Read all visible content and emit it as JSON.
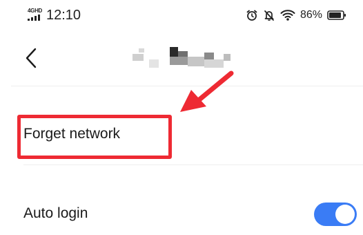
{
  "status_bar": {
    "network_type": "4GHD",
    "time": "12:10",
    "battery_percent": "86%",
    "icons": [
      "signal-icon",
      "alarm-icon",
      "mute-icon",
      "wifi-icon",
      "battery-icon"
    ]
  },
  "header": {
    "back_icon": "chevron-left-icon",
    "network_name_redacted": true
  },
  "settings": {
    "forget_network_label": "Forget network",
    "auto_login_label": "Auto login",
    "auto_login_enabled": true
  },
  "annotation": {
    "highlight_color": "#ee2a33",
    "target": "forget-network"
  },
  "colors": {
    "toggle_on": "#3a7cf5",
    "highlight": "#ee2a33"
  }
}
